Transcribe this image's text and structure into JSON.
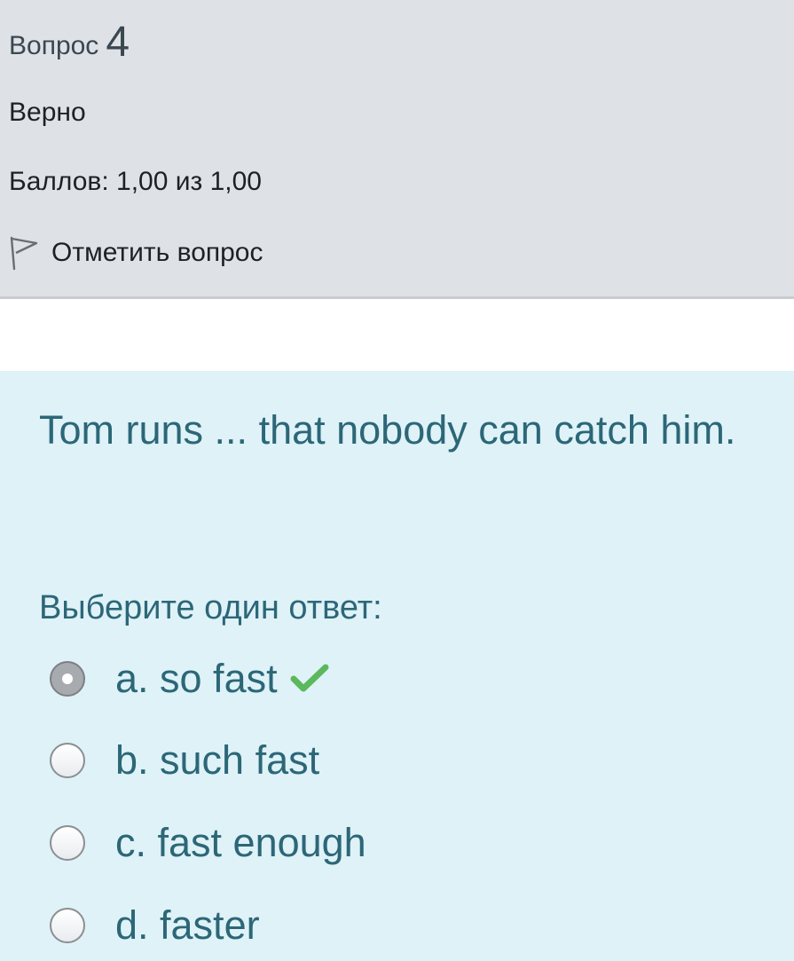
{
  "question": {
    "word": "Вопрос",
    "number": "4",
    "state": "Верно",
    "grade": "Баллов: 1,00 из 1,00",
    "flag_label": "Отметить вопрос",
    "text": "Tom runs ... that nobody can catch him.",
    "prompt": "Выберите один ответ:"
  },
  "answers": [
    {
      "label": "a. so fast",
      "selected": true,
      "correct": true
    },
    {
      "label": "b. such fast",
      "selected": false
    },
    {
      "label": "c. fast enough",
      "selected": false
    },
    {
      "label": "d. faster",
      "selected": false
    }
  ],
  "icons": {
    "flag": "flag-outline-icon",
    "correct": "checkmark-icon"
  },
  "colors": {
    "info_bg": "#dee2e6",
    "content_bg": "#def2f8",
    "content_text": "#2c6777",
    "correct": "#5cb85c"
  }
}
